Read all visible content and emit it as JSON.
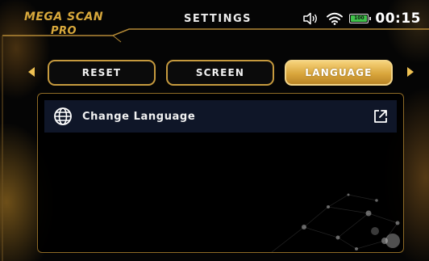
{
  "header": {
    "logo_line1": "MEGA SCAN",
    "logo_line2": "PRO",
    "title": "SETTINGS",
    "status": {
      "icons": [
        "speaker-icon",
        "wifi-icon",
        "battery-icon"
      ],
      "battery_label": "100",
      "battery_level": 1.0,
      "time": "00:15"
    }
  },
  "tabs": [
    {
      "label": "RESET",
      "active": false
    },
    {
      "label": "SCREEN",
      "active": false
    },
    {
      "label": "LANGUAGE",
      "active": true
    }
  ],
  "nav": {
    "left_icon": "triangle-left-icon",
    "right_icon": "triangle-right-icon"
  },
  "panel": {
    "items": [
      {
        "icon": "globe-icon",
        "label": "Change Language",
        "action_icon": "external-link-icon"
      }
    ]
  },
  "colors": {
    "accent_gold": "#d9a93c",
    "border_gold": "#c69a3e",
    "active_tab": "#e2b24c",
    "row_bg": "#0f1628",
    "battery_green": "#3fc24a"
  }
}
